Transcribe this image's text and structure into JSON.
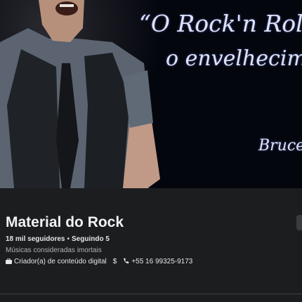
{
  "cover": {
    "quote_line_1": "“O Rock'n Rol",
    "quote_line_2": "o envelhecim",
    "quote_author": "Bruce"
  },
  "profile": {
    "name": "Material do Rock",
    "followers": "18 mil seguidores",
    "following": "Seguindo 5",
    "bio": "Músicas consideradas imortais",
    "category": "Criador(a) de conteúdo digital",
    "dollar": "$",
    "phone": "+55 16 99325-9173"
  },
  "colors": {
    "background": "#1c1d1f",
    "cover_background": "#04060e",
    "quote_text": "#dfe3f7"
  }
}
